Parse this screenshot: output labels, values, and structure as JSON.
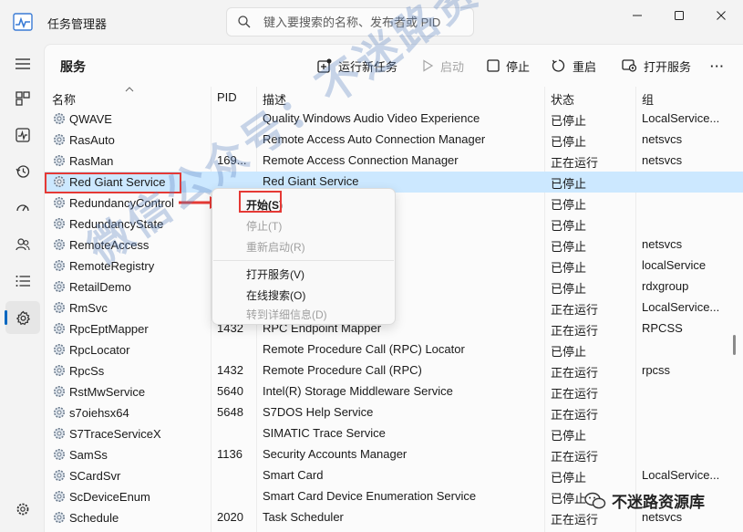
{
  "window": {
    "title": "任务管理器",
    "search_placeholder": "键入要搜索的名称、发布者或 PID"
  },
  "page": {
    "title": "服务"
  },
  "toolbar": {
    "run_new_task": "运行新任务",
    "start": "启动",
    "stop": "停止",
    "restart": "重启",
    "open_services": "打开服务",
    "more": "···"
  },
  "columns": {
    "name": "名称",
    "pid": "PID",
    "desc": "描述",
    "status": "状态",
    "group": "组"
  },
  "rows": [
    {
      "name": "QWAVE",
      "pid": "",
      "desc": "Quality Windows Audio Video Experience",
      "status": "已停止",
      "group": "LocalService..."
    },
    {
      "name": "RasAuto",
      "pid": "",
      "desc": "Remote Access Auto Connection Manager",
      "status": "已停止",
      "group": "netsvcs"
    },
    {
      "name": "RasMan",
      "pid": "169...",
      "desc": "Remote Access Connection Manager",
      "status": "正在运行",
      "group": "netsvcs"
    },
    {
      "name": "Red Giant Service",
      "pid": "",
      "desc": "Red Giant Service",
      "status": "已停止",
      "group": ""
    },
    {
      "name": "RedundancyControl",
      "pid": "",
      "desc": "",
      "status": "已停止",
      "group": ""
    },
    {
      "name": "RedundancyState",
      "pid": "",
      "desc": "",
      "status": "已停止",
      "group": ""
    },
    {
      "name": "RemoteAccess",
      "pid": "",
      "desc": "ccess",
      "status": "已停止",
      "group": "netsvcs"
    },
    {
      "name": "RemoteRegistry",
      "pid": "",
      "desc": "",
      "status": "已停止",
      "group": "localService"
    },
    {
      "name": "RetailDemo",
      "pid": "",
      "desc": "",
      "status": "已停止",
      "group": "rdxgroup"
    },
    {
      "name": "RmSvc",
      "pid": "",
      "desc": "",
      "status": "正在运行",
      "group": "LocalService..."
    },
    {
      "name": "RpcEptMapper",
      "pid": "1432",
      "desc": "RPC Endpoint Mapper",
      "status": "正在运行",
      "group": "RPCSS"
    },
    {
      "name": "RpcLocator",
      "pid": "",
      "desc": "Remote Procedure Call (RPC) Locator",
      "status": "已停止",
      "group": ""
    },
    {
      "name": "RpcSs",
      "pid": "1432",
      "desc": "Remote Procedure Call (RPC)",
      "status": "正在运行",
      "group": "rpcss"
    },
    {
      "name": "RstMwService",
      "pid": "5640",
      "desc": "Intel(R) Storage Middleware Service",
      "status": "正在运行",
      "group": ""
    },
    {
      "name": "s7oiehsx64",
      "pid": "5648",
      "desc": "S7DOS Help Service",
      "status": "正在运行",
      "group": ""
    },
    {
      "name": "S7TraceServiceX",
      "pid": "",
      "desc": "SIMATIC Trace Service",
      "status": "已停止",
      "group": ""
    },
    {
      "name": "SamSs",
      "pid": "1136",
      "desc": "Security Accounts Manager",
      "status": "正在运行",
      "group": ""
    },
    {
      "name": "SCardSvr",
      "pid": "",
      "desc": "Smart Card",
      "status": "已停止",
      "group": "LocalService..."
    },
    {
      "name": "ScDeviceEnum",
      "pid": "",
      "desc": "Smart Card Device Enumeration Service",
      "status": "已停止",
      "group": ""
    },
    {
      "name": "Schedule",
      "pid": "2020",
      "desc": "Task Scheduler",
      "status": "正在运行",
      "group": "netsvcs"
    }
  ],
  "context_menu": {
    "start": "开始(S)",
    "stop": "停止(T)",
    "restart": "重新启动(R)",
    "open_services": "打开服务(V)",
    "search_online": "在线搜索(O)",
    "go_to_details": "转到详细信息(D)"
  },
  "watermark": "微信公众号：不迷路资源库",
  "brand": "不迷路资源库",
  "colors": {
    "accent": "#0067c0",
    "selected_row": "#cce8ff",
    "annotation": "#e53935"
  }
}
